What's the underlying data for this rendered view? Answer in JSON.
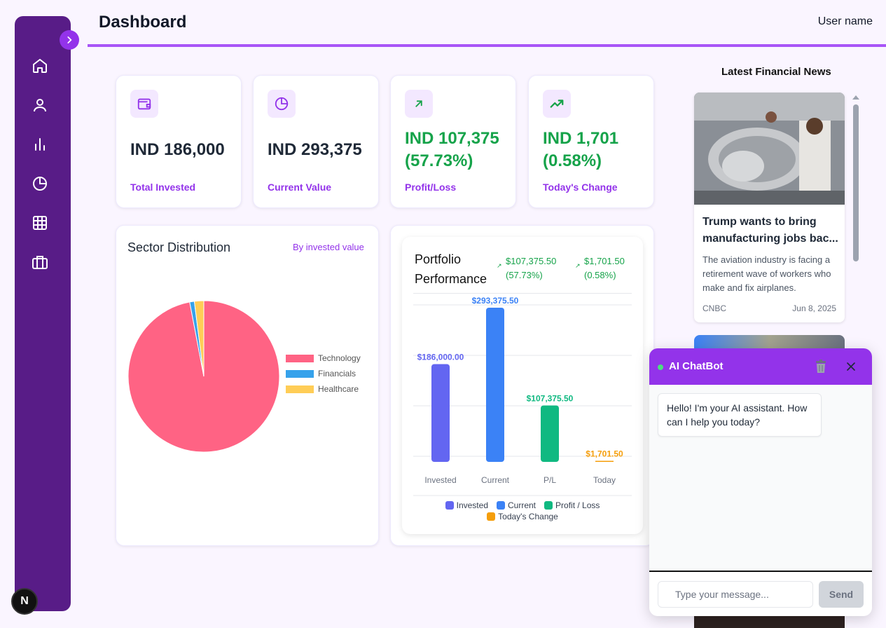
{
  "header": {
    "title": "Dashboard",
    "user_name": "User name"
  },
  "sidebar": {
    "items": [
      {
        "icon": "home-icon"
      },
      {
        "icon": "user-icon"
      },
      {
        "icon": "bar-chart-icon"
      },
      {
        "icon": "pie-chart-icon"
      },
      {
        "icon": "grid-icon"
      },
      {
        "icon": "briefcase-icon"
      }
    ],
    "footer_badge": "N"
  },
  "stats": [
    {
      "value": "IND 186,000",
      "label": "Total Invested",
      "icon": "wallet-icon"
    },
    {
      "value": "IND 293,375",
      "label": "Current Value",
      "icon": "pie-chart-icon"
    },
    {
      "value": "IND 107,375 (57.73%)",
      "label": "Profit/Loss",
      "icon": "arrow-up-right-icon",
      "color": "#16a34a"
    },
    {
      "value": "IND 1,701 (0.58%)",
      "label": "Today's Change",
      "icon": "trending-up-icon",
      "color": "#16a34a"
    }
  ],
  "sector": {
    "title": "Sector Distribution",
    "subtitle": "By invested value"
  },
  "performance": {
    "title": "Portfolio Performance",
    "pl_amount": "$107,375.50",
    "pl_percent": "(57.73%)",
    "today_amount": "$1,701.50",
    "today_percent": "(0.58%)"
  },
  "chart_data": [
    {
      "type": "pie",
      "labels": [
        "Technology",
        "Financials",
        "Healthcare"
      ],
      "values": [
        97,
        1,
        2
      ],
      "colors": [
        "#ff6384",
        "#36a2eb",
        "#ffcd56"
      ],
      "legend_position": "right"
    },
    {
      "type": "bar",
      "categories": [
        "Invested",
        "Current",
        "P/L",
        "Today"
      ],
      "values": [
        186000.0,
        293375.5,
        107375.5,
        1701.5
      ],
      "data_labels": [
        "$186,000.00",
        "$293,375.50",
        "$107,375.50",
        "$1,701.50"
      ],
      "legend": [
        "Invested",
        "Current",
        "Profit / Loss",
        "Today's Change"
      ],
      "colors": [
        "#6366f1",
        "#3b82f6",
        "#10b981",
        "#f59e0b"
      ],
      "ylim": [
        0,
        320000
      ],
      "grid": true,
      "legend_position": "bottom"
    }
  ],
  "news": {
    "heading": "Latest Financial News",
    "items": [
      {
        "title": "Trump wants to bring manufacturing jobs bac...",
        "description": "The aviation industry is facing a retirement wave of workers who make and fix airplanes.",
        "source": "CNBC",
        "date": "Jun 8, 2025"
      }
    ]
  },
  "chatbot": {
    "title": "AI ChatBot",
    "greeting": "Hello! I'm your AI assistant. How can I help you today?",
    "input_placeholder": "Type your message...",
    "send_label": "Send"
  }
}
